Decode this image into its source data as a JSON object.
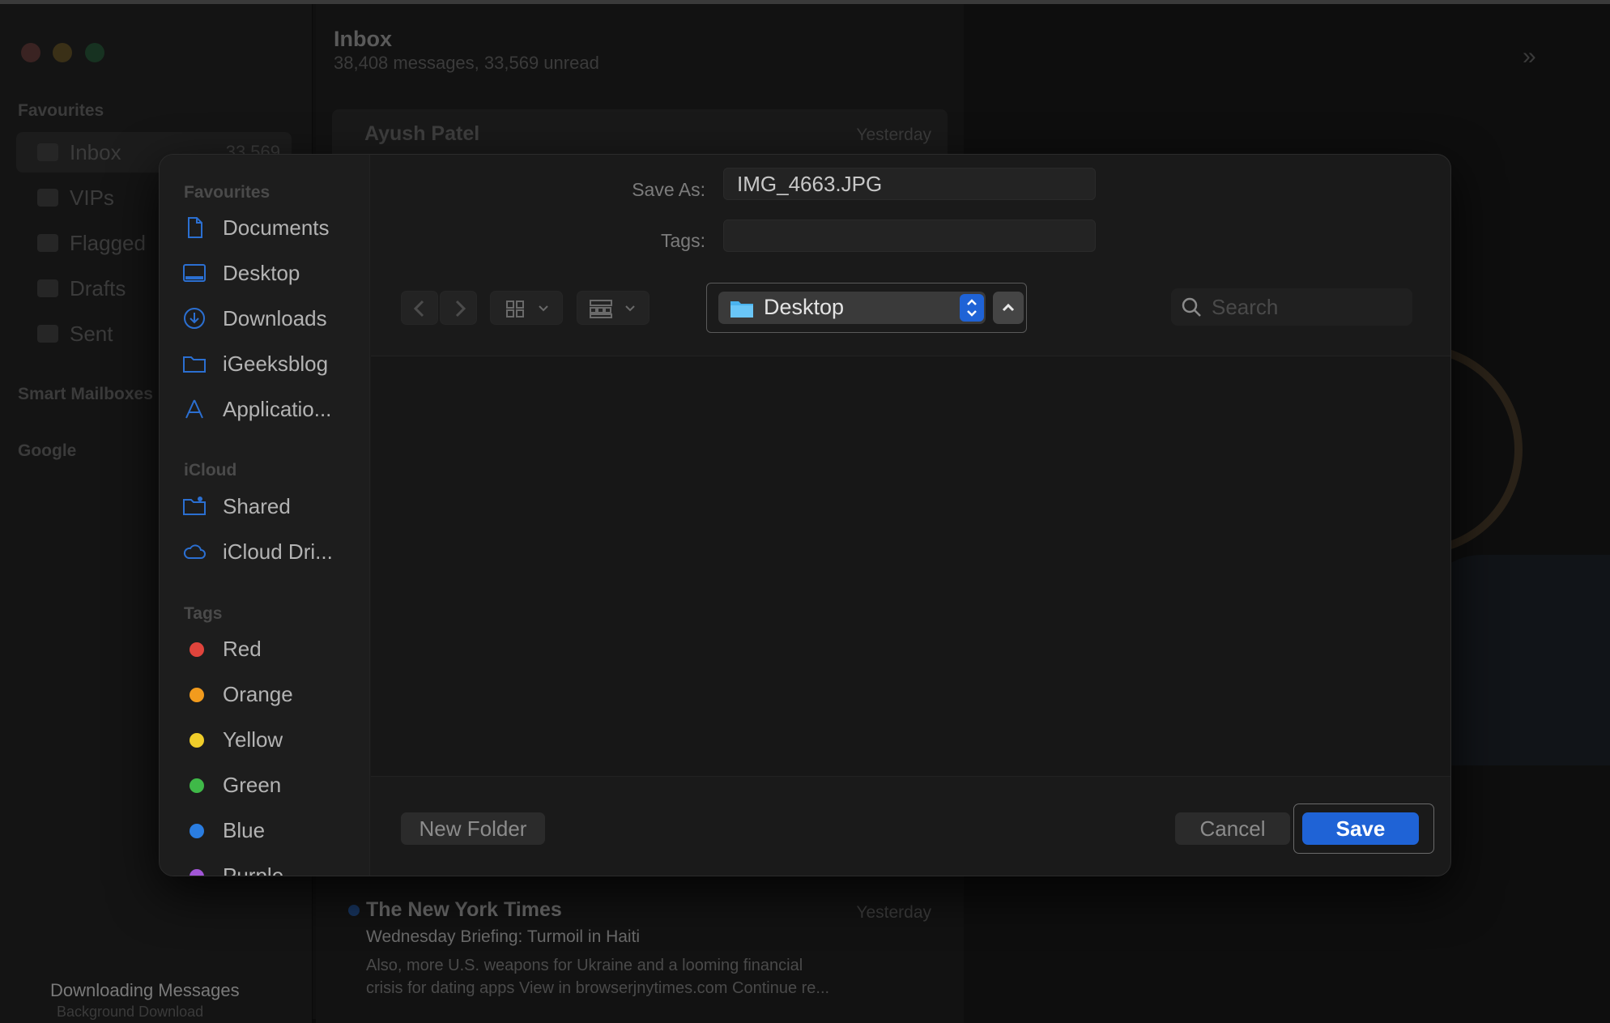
{
  "mail": {
    "title": "Inbox",
    "subtitle": "38,408 messages, 33,569 unread",
    "sidebar_heading": "Favourites",
    "mailboxes": [
      {
        "label": "Inbox",
        "count": "33,569"
      },
      {
        "label": "VIPs"
      },
      {
        "label": "Flagged"
      },
      {
        "label": "Drafts"
      },
      {
        "label": "Sent"
      }
    ],
    "smart_heading": "Smart Mailboxes",
    "google_heading": "Google",
    "status": "Downloading Messages",
    "status_sub": "Background Download",
    "messages": [
      {
        "sender": "Ayush Patel",
        "date": "Yesterday"
      },
      {
        "sender": "The New York Times",
        "date": "Yesterday",
        "subject": "Wednesday Briefing: Turmoil in Haiti",
        "preview_line1": "Also, more U.S. weapons for Ukraine and a looming financial",
        "preview_line2": "crisis for dating apps View in browserjnytimes.com Continue re..."
      }
    ]
  },
  "dialog": {
    "save_as_label": "Save As:",
    "filename": "IMG_4663.JPG",
    "tags_label": "Tags:",
    "tags_value": "",
    "location": "Desktop",
    "search_placeholder": "Search",
    "new_folder": "New Folder",
    "cancel": "Cancel",
    "save": "Save",
    "sidebar": {
      "favourites_heading": "Favourites",
      "favourites": [
        {
          "label": "Documents",
          "icon": "document-icon"
        },
        {
          "label": "Desktop",
          "icon": "desktop-icon"
        },
        {
          "label": "Downloads",
          "icon": "downloads-icon"
        },
        {
          "label": "iGeeksblog",
          "icon": "folder-icon"
        },
        {
          "label": "Applicatio...",
          "icon": "applications-icon"
        }
      ],
      "icloud_heading": "iCloud",
      "icloud": [
        {
          "label": "Shared",
          "icon": "shared-folder-icon"
        },
        {
          "label": "iCloud Dri...",
          "icon": "cloud-icon"
        }
      ],
      "tags_heading": "Tags",
      "tags": [
        {
          "label": "Red",
          "color": "#e0443c"
        },
        {
          "label": "Orange",
          "color": "#f29b1d"
        },
        {
          "label": "Yellow",
          "color": "#f0cd2a"
        },
        {
          "label": "Green",
          "color": "#3fb948"
        },
        {
          "label": "Blue",
          "color": "#2a7de1"
        },
        {
          "label": "Purple",
          "color": "#a156d6"
        }
      ]
    }
  },
  "colors": {
    "accent": "#1f63d6",
    "traffic_red": "#ff5f57",
    "traffic_yellow": "#febc2e",
    "traffic_green": "#28c840"
  }
}
